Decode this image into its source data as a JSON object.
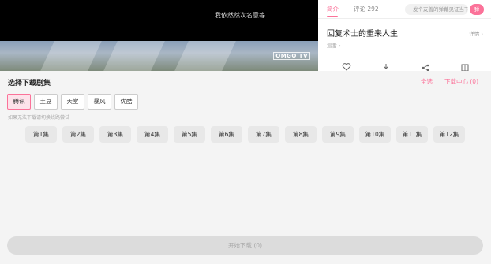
{
  "player": {
    "danmaku_text": "我依然然次名意等",
    "watermark": "OMGO TV"
  },
  "side": {
    "tabs": [
      "简介",
      "评论 292"
    ],
    "danmaku_pill": "发个友善的弹幕见证当下",
    "danmaku_send": "弹",
    "title": "回复术士的重来人生",
    "detail": "详情 ›",
    "sub": "追番 ›",
    "icons": [
      "heart-icon",
      "download-icon",
      "share-icon",
      "book-icon"
    ]
  },
  "download": {
    "title": "选择下载剧集",
    "select_all": "全选",
    "download_center": "下载中心 (0)",
    "sources": [
      "腾讯",
      "土豆",
      "天堂",
      "暴风",
      "优酷"
    ],
    "active_source": "腾讯",
    "hint": "如果无法下载请切换线路尝试",
    "episodes": [
      "第1集",
      "第2集",
      "第3集",
      "第4集",
      "第5集",
      "第6集",
      "第7集",
      "第8集",
      "第9集",
      "第10集",
      "第11集",
      "第12集"
    ],
    "start_label": "开始下载 (0)"
  },
  "colors": {
    "accent": "#fb7299",
    "panel_bg": "#f4f4f4",
    "episode_bg": "#e8e8e8"
  }
}
